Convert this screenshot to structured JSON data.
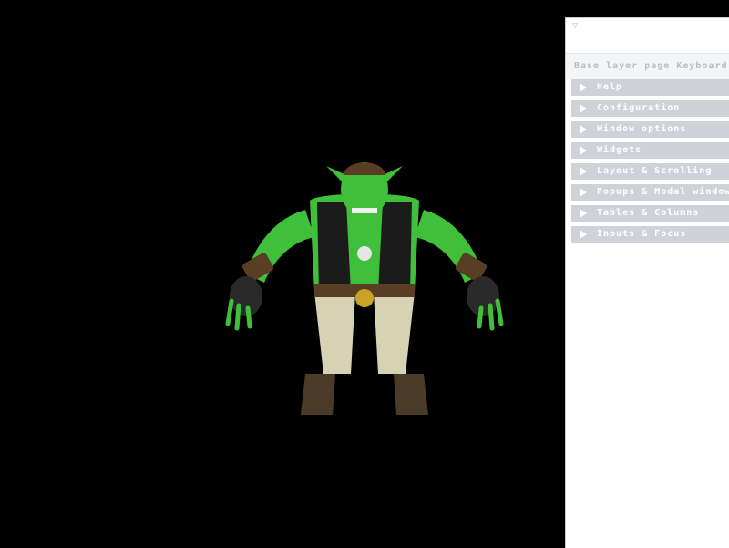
{
  "panel": {
    "collapse_glyph": "▽",
    "header": "Base layer page Keyboard Options",
    "sections": [
      {
        "label": "Help"
      },
      {
        "label": "Configuration"
      },
      {
        "label": "Window options"
      },
      {
        "label": "Widgets"
      },
      {
        "label": "Layout & Scrolling"
      },
      {
        "label": "Popups & Modal windows"
      },
      {
        "label": "Tables & Columns"
      },
      {
        "label": "Inputs & Focus"
      }
    ]
  },
  "scene": {
    "subject": "3D orc character model",
    "background_color": "#000000",
    "skin_color": "#3fbf3a",
    "pants_color": "#d8d2b4",
    "vest_color": "#1b1b1b"
  }
}
